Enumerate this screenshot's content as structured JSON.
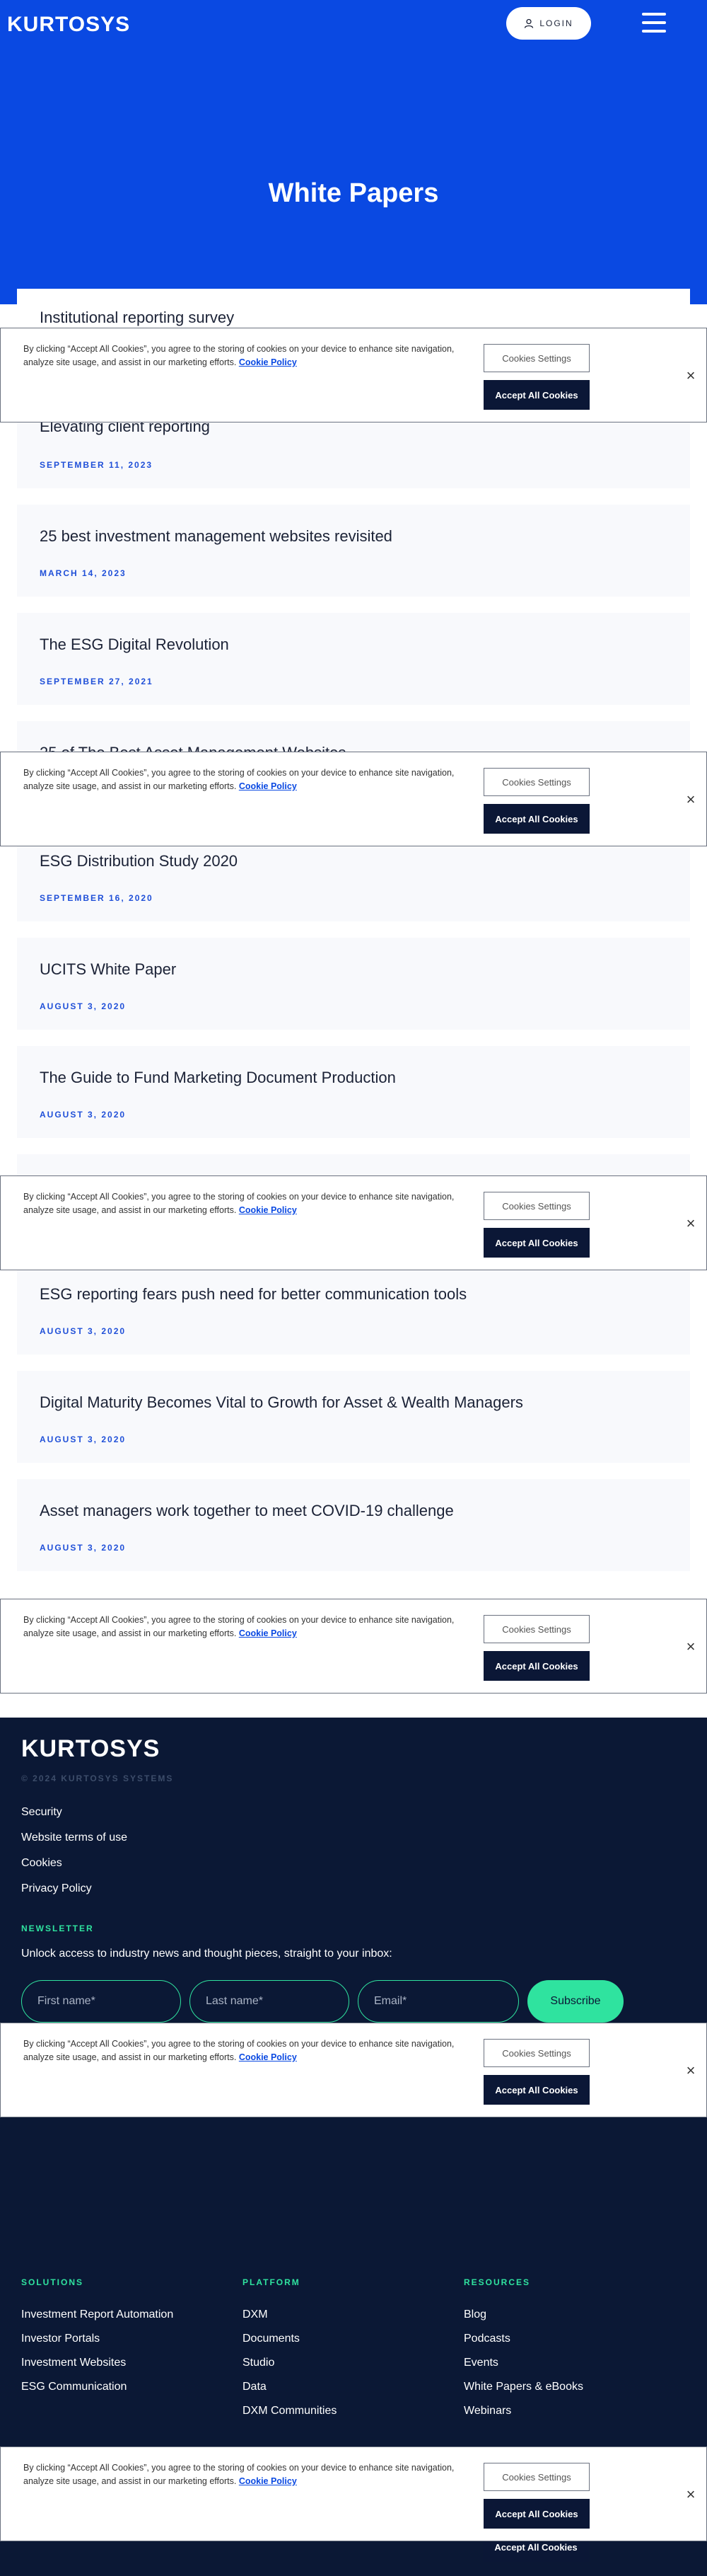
{
  "header": {
    "logo": "KURTOSYS",
    "login_label": "LOGIN",
    "page_title": "White Papers"
  },
  "papers": [
    {
      "title": "Institutional reporting survey",
      "date": ""
    },
    {
      "title": "Elevating client reporting",
      "date": "SEPTEMBER 11, 2023"
    },
    {
      "title": "25 best investment management websites revisited",
      "date": "MARCH 14, 2023"
    },
    {
      "title": "The ESG Digital Revolution",
      "date": "SEPTEMBER 27, 2021"
    },
    {
      "title": "25 of The Best Asset Management Websites",
      "date": ""
    },
    {
      "title": "ESG Distribution Study 2020",
      "date": "SEPTEMBER 16, 2020"
    },
    {
      "title": "UCITS White Paper",
      "date": "AUGUST 3, 2020"
    },
    {
      "title": "The Guide to Fund Marketing Document Production",
      "date": "AUGUST 3, 2020"
    },
    {
      "title": "",
      "date": ""
    },
    {
      "title": "ESG reporting fears push need for better communication tools",
      "date": "AUGUST 3, 2020"
    },
    {
      "title": "Digital Maturity Becomes Vital to Growth for Asset & Wealth Managers",
      "date": "AUGUST 3, 2020"
    },
    {
      "title": "Asset managers work together to meet COVID-19 challenge",
      "date": "AUGUST 3, 2020"
    }
  ],
  "cookie": {
    "text": "By clicking “Accept All Cookies”, you agree to the storing of cookies on your device to enhance site navigation, analyze site usage, and assist in our marketing efforts.",
    "link": "Cookie Policy",
    "settings_label": "Cookies Settings",
    "accept_label": "Accept All Cookies",
    "close": "×"
  },
  "footer": {
    "logo": "KURTOSYS",
    "copyright": "© 2024 KURTOSYS SYSTEMS",
    "links": [
      "Security",
      "Website terms of use",
      "Cookies",
      "Privacy Policy"
    ],
    "newsletter": {
      "label": "NEWSLETTER",
      "text": "Unlock access to industry news and thought pieces, straight to your inbox:",
      "first_name_placeholder": "First name*",
      "last_name_placeholder": "Last name*",
      "email_placeholder": "Email*",
      "subscribe_label": "Subscribe"
    },
    "columns": [
      {
        "heading": "SOLUTIONS",
        "items": [
          "Investment Report Automation",
          "Investor Portals",
          "Investment Websites",
          "ESG Communication"
        ]
      },
      {
        "heading": "PLATFORM",
        "items": [
          "DXM",
          "Documents",
          "Studio",
          "Data",
          "DXM Communities"
        ]
      },
      {
        "heading": "RESOURCES",
        "items": [
          "Blog",
          "Podcasts",
          "Events",
          "White Papers & eBooks",
          "Webinars"
        ]
      }
    ]
  },
  "colors": {
    "hero_blue": "#0a49e2",
    "footer_navy": "#0b1835",
    "accent_green": "#2fe39f",
    "date_blue": "#1f4fd8"
  }
}
